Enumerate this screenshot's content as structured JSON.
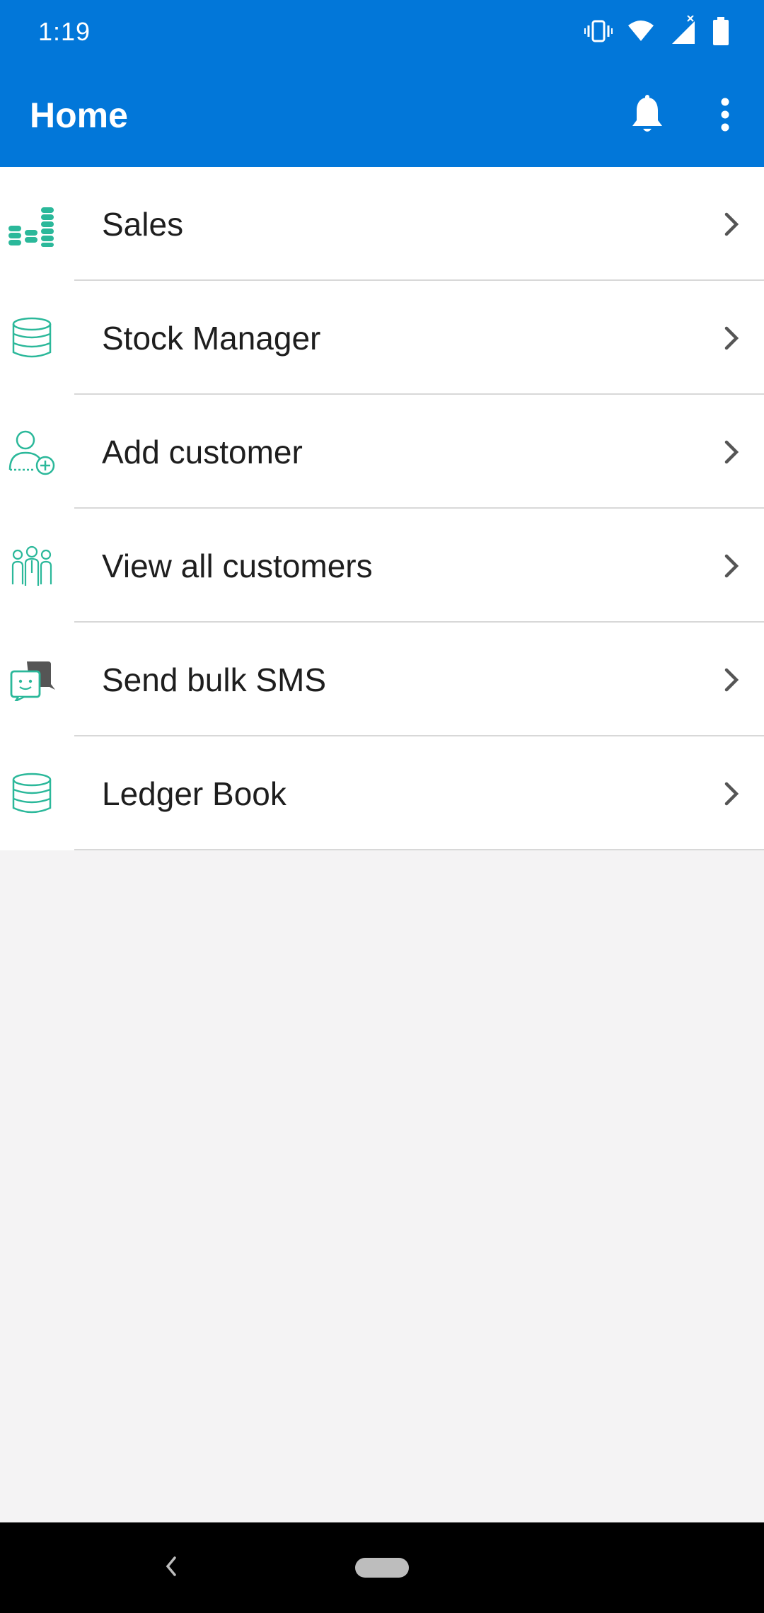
{
  "status_bar": {
    "time": "1:19",
    "icons": [
      "vibrate-icon",
      "wifi-icon",
      "signal-icon",
      "battery-icon"
    ]
  },
  "app_bar": {
    "title": "Home",
    "actions": [
      "notification-bell-icon",
      "more-vert-icon"
    ]
  },
  "menu": {
    "items": [
      {
        "label": "Sales",
        "icon": "coins-stack-icon"
      },
      {
        "label": "Stock Manager",
        "icon": "database-icon"
      },
      {
        "label": "Add customer",
        "icon": "add-user-icon"
      },
      {
        "label": "View all customers",
        "icon": "customers-group-icon"
      },
      {
        "label": "Send bulk SMS",
        "icon": "chat-bubbles-icon"
      },
      {
        "label": "Ledger Book",
        "icon": "database-icon"
      }
    ]
  },
  "colors": {
    "primary": "#0277d9",
    "icon_accent": "#2bb89a",
    "background": "#f4f3f4"
  }
}
